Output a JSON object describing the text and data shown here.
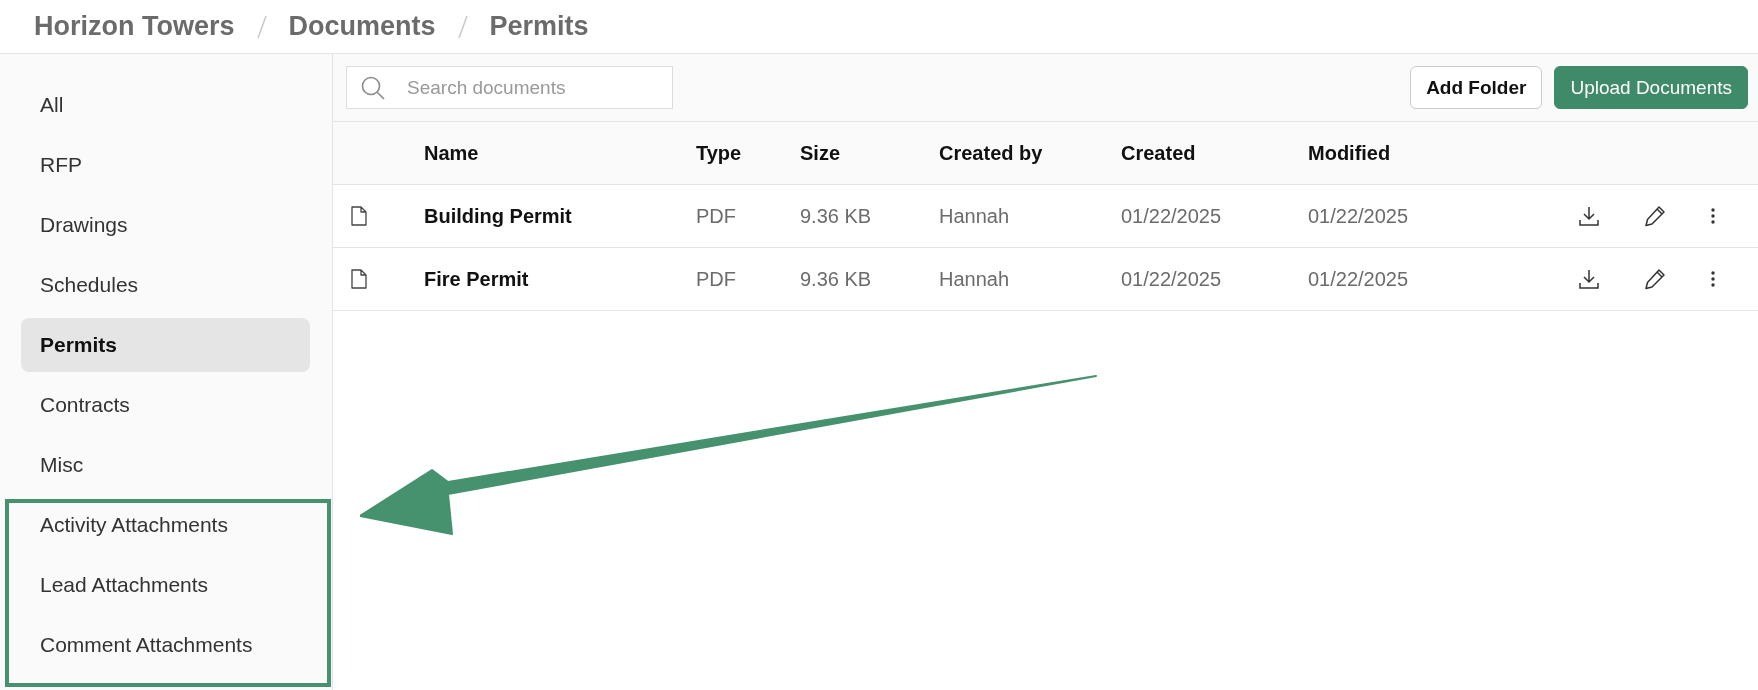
{
  "breadcrumb": [
    "Horizon Towers",
    "Documents",
    "Permits"
  ],
  "sidebar": {
    "items": [
      {
        "label": "All",
        "selected": false
      },
      {
        "label": "RFP",
        "selected": false
      },
      {
        "label": "Drawings",
        "selected": false
      },
      {
        "label": "Schedules",
        "selected": false
      },
      {
        "label": "Permits",
        "selected": true
      },
      {
        "label": "Contracts",
        "selected": false
      },
      {
        "label": "Misc",
        "selected": false
      },
      {
        "label": "Activity Attachments",
        "selected": false
      },
      {
        "label": "Lead Attachments",
        "selected": false
      },
      {
        "label": "Comment Attachments",
        "selected": false
      }
    ]
  },
  "search": {
    "placeholder": "Search documents"
  },
  "buttons": [
    {
      "label": "Add Folder",
      "kind": "secondary"
    },
    {
      "label": "Upload Documents",
      "kind": "primary"
    }
  ],
  "table": {
    "columns": [
      "Name",
      "Type",
      "Size",
      "Created by",
      "Created",
      "Modified"
    ],
    "rows": [
      {
        "name": "Building Permit",
        "type": "PDF",
        "size": "9.36 KB",
        "created_by": "Hannah",
        "created": "01/22/2025",
        "modified": "01/22/2025"
      },
      {
        "name": "Fire Permit",
        "type": "PDF",
        "size": "9.36 KB",
        "created_by": "Hannah",
        "created": "01/22/2025",
        "modified": "01/22/2025"
      }
    ]
  }
}
